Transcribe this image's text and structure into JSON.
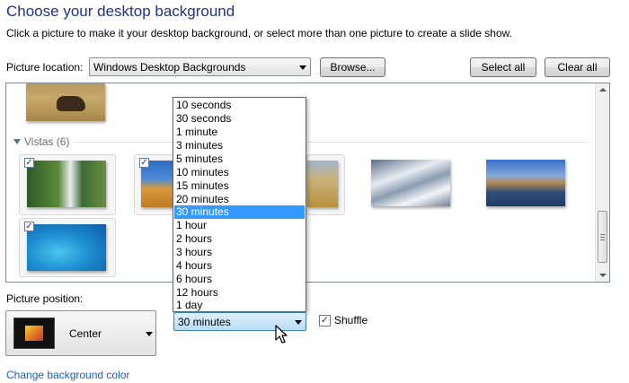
{
  "header": {
    "title": "Choose your desktop background",
    "subtitle": "Click a picture to make it your desktop background, or select more than one picture to create a slide show."
  },
  "location": {
    "label": "Picture location:",
    "value": "Windows Desktop Backgrounds",
    "browse_label": "Browse...",
    "select_all_label": "Select all",
    "clear_all_label": "Clear all"
  },
  "gallery": {
    "group_label": "Vistas (6)",
    "group_expanded": true,
    "items": [
      {
        "name": "bison",
        "checked": false
      },
      {
        "name": "waterfall",
        "checked": true
      },
      {
        "name": "desert-dunes",
        "checked": true
      },
      {
        "name": "wheat-field",
        "checked": false
      },
      {
        "name": "snowy-mountains",
        "checked": false
      },
      {
        "name": "lake-mountains",
        "checked": false
      },
      {
        "name": "blue-fish",
        "checked": true
      }
    ]
  },
  "interval_dropdown": {
    "options": [
      "10 seconds",
      "30 seconds",
      "1 minute",
      "3 minutes",
      "5 minutes",
      "10 minutes",
      "15 minutes",
      "20 minutes",
      "30 minutes",
      "1 hour",
      "2 hours",
      "3 hours",
      "4 hours",
      "6 hours",
      "12 hours",
      "1 day"
    ],
    "selected": "30 minutes",
    "highlighted_index": 8
  },
  "position": {
    "label": "Picture position:",
    "value": "Center"
  },
  "shuffle": {
    "label": "Shuffle",
    "checked": true
  },
  "footer": {
    "link_label": "Change background color"
  },
  "colors": {
    "title": "#1e3287",
    "link": "#1a5fb4",
    "selection": "#3399ff"
  }
}
